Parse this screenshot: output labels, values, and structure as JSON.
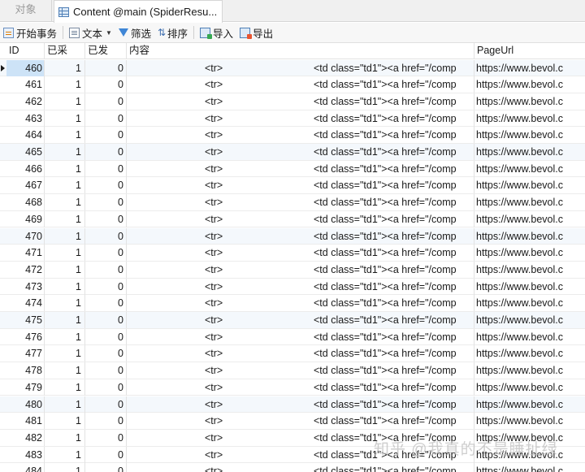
{
  "tabs": {
    "objects_label": "对象",
    "active_label": "Content @main (SpiderResu..."
  },
  "toolbar": {
    "begin_transaction": "开始事务",
    "text": "文本",
    "filter": "筛选",
    "sort": "排序",
    "import": "导入",
    "export": "导出"
  },
  "columns": [
    "ID",
    "已采",
    "已发",
    "内容",
    "PageUrl"
  ],
  "rows": [
    {
      "id": "460",
      "cai": "1",
      "fa": "0",
      "content_a": "<tr>",
      "content_b": "<td class=\"td1\"><a href=\"/comp",
      "url": "https://www.bevol.c"
    },
    {
      "id": "461",
      "cai": "1",
      "fa": "0",
      "content_a": "<tr>",
      "content_b": "<td class=\"td1\"><a href=\"/comp",
      "url": "https://www.bevol.c"
    },
    {
      "id": "462",
      "cai": "1",
      "fa": "0",
      "content_a": "<tr>",
      "content_b": "<td class=\"td1\"><a href=\"/comp",
      "url": "https://www.bevol.c"
    },
    {
      "id": "463",
      "cai": "1",
      "fa": "0",
      "content_a": "<tr>",
      "content_b": "<td class=\"td1\"><a href=\"/comp",
      "url": "https://www.bevol.c"
    },
    {
      "id": "464",
      "cai": "1",
      "fa": "0",
      "content_a": "<tr>",
      "content_b": "<td class=\"td1\"><a href=\"/comp",
      "url": "https://www.bevol.c"
    },
    {
      "id": "465",
      "cai": "1",
      "fa": "0",
      "content_a": "<tr>",
      "content_b": "<td class=\"td1\"><a href=\"/comp",
      "url": "https://www.bevol.c"
    },
    {
      "id": "466",
      "cai": "1",
      "fa": "0",
      "content_a": "<tr>",
      "content_b": "<td class=\"td1\"><a href=\"/comp",
      "url": "https://www.bevol.c"
    },
    {
      "id": "467",
      "cai": "1",
      "fa": "0",
      "content_a": "<tr>",
      "content_b": "<td class=\"td1\"><a href=\"/comp",
      "url": "https://www.bevol.c"
    },
    {
      "id": "468",
      "cai": "1",
      "fa": "0",
      "content_a": "<tr>",
      "content_b": "<td class=\"td1\"><a href=\"/comp",
      "url": "https://www.bevol.c"
    },
    {
      "id": "469",
      "cai": "1",
      "fa": "0",
      "content_a": "<tr>",
      "content_b": "<td class=\"td1\"><a href=\"/comp",
      "url": "https://www.bevol.c"
    },
    {
      "id": "470",
      "cai": "1",
      "fa": "0",
      "content_a": "<tr>",
      "content_b": "<td class=\"td1\"><a href=\"/comp",
      "url": "https://www.bevol.c"
    },
    {
      "id": "471",
      "cai": "1",
      "fa": "0",
      "content_a": "<tr>",
      "content_b": "<td class=\"td1\"><a href=\"/comp",
      "url": "https://www.bevol.c"
    },
    {
      "id": "472",
      "cai": "1",
      "fa": "0",
      "content_a": "<tr>",
      "content_b": "<td class=\"td1\"><a href=\"/comp",
      "url": "https://www.bevol.c"
    },
    {
      "id": "473",
      "cai": "1",
      "fa": "0",
      "content_a": "<tr>",
      "content_b": "<td class=\"td1\"><a href=\"/comp",
      "url": "https://www.bevol.c"
    },
    {
      "id": "474",
      "cai": "1",
      "fa": "0",
      "content_a": "<tr>",
      "content_b": "<td class=\"td1\"><a href=\"/comp",
      "url": "https://www.bevol.c"
    },
    {
      "id": "475",
      "cai": "1",
      "fa": "0",
      "content_a": "<tr>",
      "content_b": "<td class=\"td1\"><a href=\"/comp",
      "url": "https://www.bevol.c"
    },
    {
      "id": "476",
      "cai": "1",
      "fa": "0",
      "content_a": "<tr>",
      "content_b": "<td class=\"td1\"><a href=\"/comp",
      "url": "https://www.bevol.c"
    },
    {
      "id": "477",
      "cai": "1",
      "fa": "0",
      "content_a": "<tr>",
      "content_b": "<td class=\"td1\"><a href=\"/comp",
      "url": "https://www.bevol.c"
    },
    {
      "id": "478",
      "cai": "1",
      "fa": "0",
      "content_a": "<tr>",
      "content_b": "<td class=\"td1\"><a href=\"/comp",
      "url": "https://www.bevol.c"
    },
    {
      "id": "479",
      "cai": "1",
      "fa": "0",
      "content_a": "<tr>",
      "content_b": "<td class=\"td1\"><a href=\"/comp",
      "url": "https://www.bevol.c"
    },
    {
      "id": "480",
      "cai": "1",
      "fa": "0",
      "content_a": "<tr>",
      "content_b": "<td class=\"td1\"><a href=\"/comp",
      "url": "https://www.bevol.c"
    },
    {
      "id": "481",
      "cai": "1",
      "fa": "0",
      "content_a": "<tr>",
      "content_b": "<td class=\"td1\"><a href=\"/comp",
      "url": "https://www.bevol.c"
    },
    {
      "id": "482",
      "cai": "1",
      "fa": "0",
      "content_a": "<tr>",
      "content_b": "<td class=\"td1\"><a href=\"/comp",
      "url": "https://www.bevol.c"
    },
    {
      "id": "483",
      "cai": "1",
      "fa": "0",
      "content_a": "<tr>",
      "content_b": "<td class=\"td1\"><a href=\"/comp",
      "url": "https://www.bevol.c"
    },
    {
      "id": "484",
      "cai": "1",
      "fa": "0",
      "content_a": "<tr>",
      "content_b": "<td class=\"td1\"><a href=\"/comp",
      "url": "https://www.bevol.c"
    }
  ],
  "watermark": "知乎 @我真的不是睡扯绿"
}
